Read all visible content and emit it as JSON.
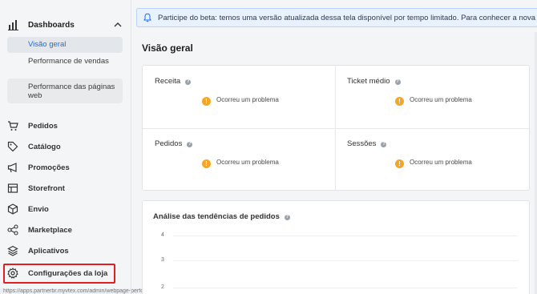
{
  "sidebar": {
    "section_label": "Dashboards",
    "sub_items": [
      {
        "label": "Visão geral"
      },
      {
        "label": "Performance de vendas"
      },
      {
        "label": "Performance das páginas web"
      }
    ],
    "items": [
      {
        "label": "Pedidos",
        "icon": "cart-icon"
      },
      {
        "label": "Catálogo",
        "icon": "tag-icon"
      },
      {
        "label": "Promoções",
        "icon": "megaphone-icon"
      },
      {
        "label": "Storefront",
        "icon": "layout-icon"
      },
      {
        "label": "Envio",
        "icon": "box-icon"
      },
      {
        "label": "Marketplace",
        "icon": "share-icon"
      },
      {
        "label": "Aplicativos",
        "icon": "layers-icon"
      },
      {
        "label": "Configurações da loja",
        "icon": "gear-icon"
      }
    ]
  },
  "status_url": "https://apps.partnerbr.myvtex.com/admin/webpage-performance",
  "banner": {
    "text": "Participe do beta: temos uma versão atualizada dessa tela disponível por tempo limitado. Para conhecer a nova e"
  },
  "page_title": "Visão geral",
  "metrics": [
    {
      "label": "Receita",
      "error": "Ocorreu um problema"
    },
    {
      "label": "Ticket médio",
      "error": "Ocorreu um problema"
    },
    {
      "label": "Pedidos",
      "error": "Ocorreu um problema"
    },
    {
      "label": "Sessões",
      "error": "Ocorreu um problema"
    }
  ],
  "help_glyph": "?",
  "warn_glyph": "!",
  "trend": {
    "title": "Análise das tendências de pedidos",
    "y_ticks": [
      "4",
      "3",
      "2"
    ]
  },
  "colors": {
    "accent": "#1a6fe0",
    "warning": "#f5a623",
    "highlight": "#e02020"
  }
}
